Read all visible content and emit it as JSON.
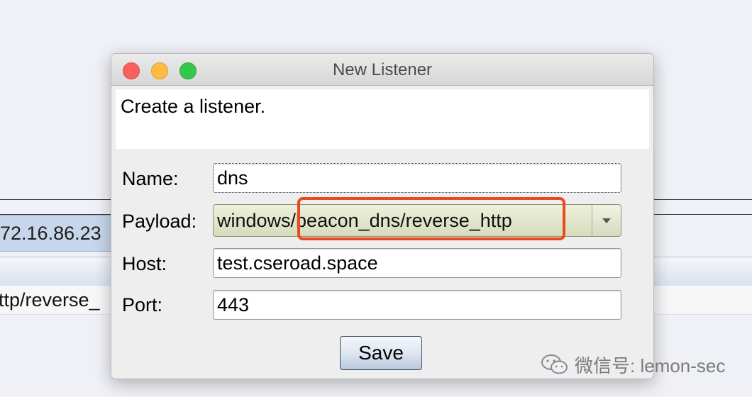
{
  "background": {
    "ip_cell": "72.16.86.23",
    "row_text": "ttp/reverse_"
  },
  "dialog": {
    "title": "New Listener",
    "description": "Create a listener.",
    "fields": {
      "name": {
        "label": "Name:",
        "value": "dns"
      },
      "payload": {
        "label": "Payload:",
        "value": "windows/beacon_dns/reverse_http"
      },
      "host": {
        "label": "Host:",
        "value": "test.cseroad.space"
      },
      "port": {
        "label": "Port:",
        "value": "443"
      }
    },
    "save_label": "Save",
    "highlight_color": "#ea4a1e"
  },
  "watermark": {
    "text": "微信号: lemon-sec",
    "icon": "wechat-icon"
  }
}
